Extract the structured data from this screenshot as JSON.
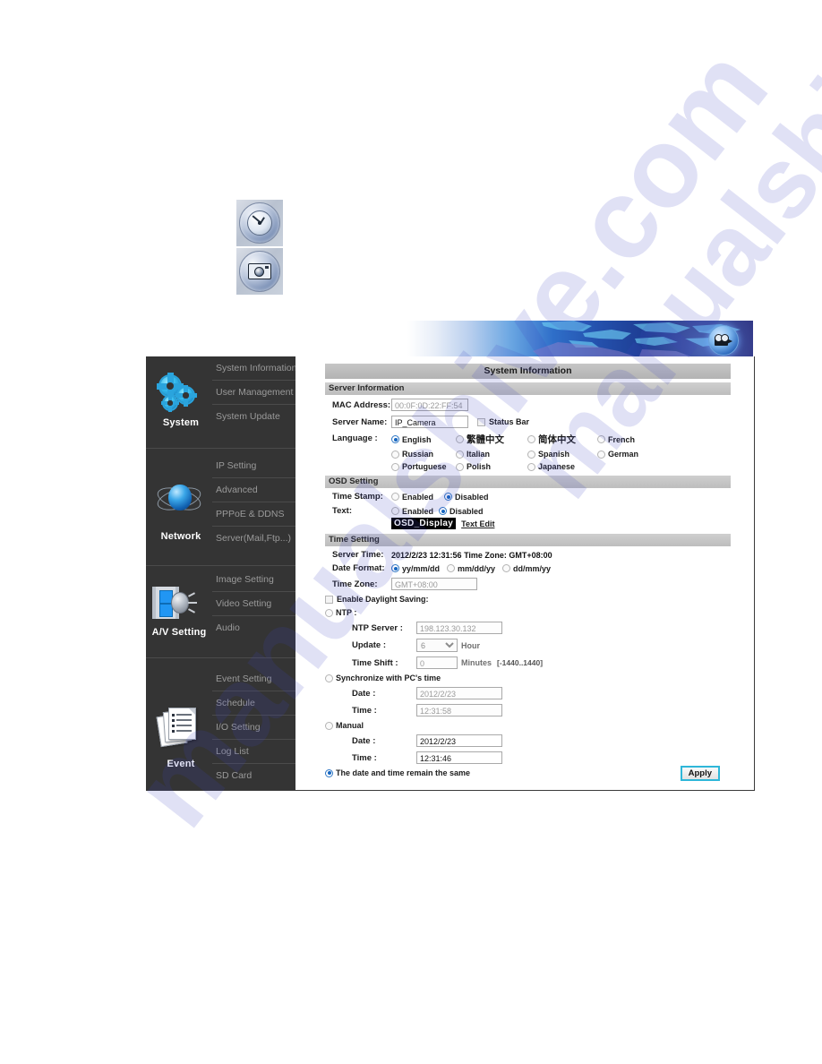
{
  "top_icons": [
    {
      "name": "time-settings-icon",
      "label": "Time"
    },
    {
      "name": "snapshot-icon",
      "label": "Snapshot"
    }
  ],
  "banner": {
    "camera_badge": "video-camera-icon"
  },
  "watermark": {
    "text_1": "manualshive.com",
    "text_2": "manualshive.com"
  },
  "sidebar": {
    "groups": [
      {
        "title": "System",
        "icon": "gears-icon",
        "items": [
          {
            "label": "System Information"
          },
          {
            "label": "User Management"
          },
          {
            "label": "System Update"
          }
        ]
      },
      {
        "title": "Network",
        "icon": "globe-icon",
        "items": [
          {
            "label": "IP Setting"
          },
          {
            "label": "Advanced"
          },
          {
            "label": "PPPoE & DDNS"
          },
          {
            "label": "Server(Mail,Ftp...)"
          }
        ]
      },
      {
        "title": "A/V Setting",
        "icon": "film-speaker-icon",
        "items": [
          {
            "label": "Image Setting"
          },
          {
            "label": "Video Setting"
          },
          {
            "label": "Audio"
          }
        ]
      },
      {
        "title": "Event",
        "icon": "document-list-icon",
        "items": [
          {
            "label": "Event Setting"
          },
          {
            "label": "Schedule"
          },
          {
            "label": "I/O Setting"
          },
          {
            "label": "Log List"
          },
          {
            "label": "SD Card"
          }
        ]
      }
    ]
  },
  "main": {
    "page_title": "System Information",
    "server_information": {
      "section_label": "Server Information",
      "mac_label": "MAC Address:",
      "mac_value": "00:0F:0D:22:FF:54",
      "server_name_label": "Server Name:",
      "server_name_value": "IP_Camera",
      "status_bar_label": "Status Bar",
      "language_label": "Language :",
      "languages": [
        {
          "label": "English",
          "selected": true
        },
        {
          "label": "繁體中文",
          "selected": false
        },
        {
          "label": "简体中文",
          "selected": false
        },
        {
          "label": "French",
          "selected": false
        },
        {
          "label": "Russian",
          "selected": false
        },
        {
          "label": "Italian",
          "selected": false
        },
        {
          "label": "Spanish",
          "selected": false
        },
        {
          "label": "German",
          "selected": false
        },
        {
          "label": "Portuguese",
          "selected": false
        },
        {
          "label": "Polish",
          "selected": false
        },
        {
          "label": "Japanese",
          "selected": false
        }
      ]
    },
    "osd_setting": {
      "section_label": "OSD Setting",
      "time_stamp_label": "Time Stamp:",
      "time_stamp_enabled_label": "Enabled",
      "time_stamp_disabled_label": "Disabled",
      "text_label": "Text:",
      "text_enabled_label": "Enabled",
      "text_disabled_label": "Disabled",
      "osd_display_value": "OSD_Display",
      "text_edit_link": "Text Edit"
    },
    "time_setting": {
      "section_label": "Time Setting",
      "server_time_label": "Server Time:",
      "server_time_value": "2012/2/23 12:31:56 Time Zone: GMT+08:00",
      "date_format_label": "Date Format:",
      "date_formats": [
        {
          "label": "yy/mm/dd",
          "selected": true
        },
        {
          "label": "mm/dd/yy",
          "selected": false
        },
        {
          "label": "dd/mm/yy",
          "selected": false
        }
      ],
      "time_zone_label": "Time Zone:",
      "time_zone_value": "GMT+08:00",
      "daylight_saving_label": "Enable Daylight Saving:",
      "ntp_label": "NTP :",
      "ntp_server_label": "NTP Server :",
      "ntp_server_value": "198.123.30.132",
      "update_label": "Update :",
      "update_value": "6",
      "update_unit": "Hour",
      "time_shift_label": "Time Shift :",
      "time_shift_value": "0",
      "time_shift_unit": "Minutes",
      "time_shift_range": "[-1440..1440]",
      "sync_pc_label": "Synchronize with PC's time",
      "sync_date_label": "Date :",
      "sync_date_value": "2012/2/23",
      "sync_time_label": "Time :",
      "sync_time_value": "12:31:58",
      "manual_label": "Manual",
      "manual_date_label": "Date :",
      "manual_date_value": "2012/2/23",
      "manual_time_label": "Time :",
      "manual_time_value": "12:31:46",
      "remain_same_label": "The date and time remain the same"
    },
    "apply_label": "Apply"
  }
}
